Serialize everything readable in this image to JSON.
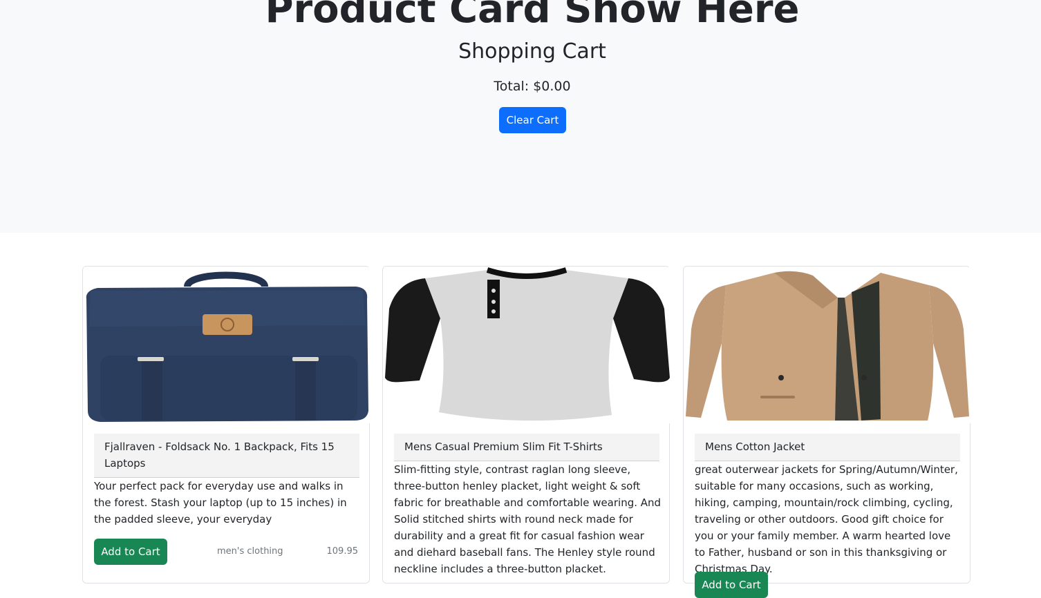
{
  "hero": {
    "title": "Product Card Show Here",
    "cart_title": "Shopping Cart",
    "total": "Total: $0.00",
    "clear_label": "Clear Cart"
  },
  "products": [
    {
      "title": "Fjallraven - Foldsack No. 1 Backpack, Fits 15 Laptops",
      "description": "Your perfect pack for everyday use and walks in the forest. Stash your laptop (up to 15 inches) in the padded sleeve, your everyday",
      "button": "Add to Cart",
      "category": "men's clothing",
      "price": "109.95",
      "image": "navy-backpack-image"
    },
    {
      "title": "Mens Casual Premium Slim Fit T-Shirts",
      "description": "Slim-fitting style, contrast raglan long sleeve, three-button henley placket, light weight & soft fabric for breathable and comfortable wearing. And Solid stitched shirts with round neck made for durability and a great fit for casual fashion wear and diehard baseball fans. The Henley style round neckline includes a three-button placket.",
      "button": "Add to Cart",
      "image": "raglan-tshirt-image"
    },
    {
      "title": "Mens Cotton Jacket",
      "description": "great outerwear jackets for Spring/Autumn/Winter, suitable for many occasions, such as working, hiking, camping, mountain/rock climbing, cycling, traveling or other outdoors. Good gift choice for you or your family member. A warm hearted love to Father, husband or son in this thanksgiving or Christmas Day.",
      "button": "Add to Cart",
      "image": "khaki-jacket-image"
    }
  ],
  "colors": {
    "primary": "#0d6efd",
    "success": "#198754",
    "hero_bg": "#f8f9fa",
    "muted": "#6c757d"
  }
}
